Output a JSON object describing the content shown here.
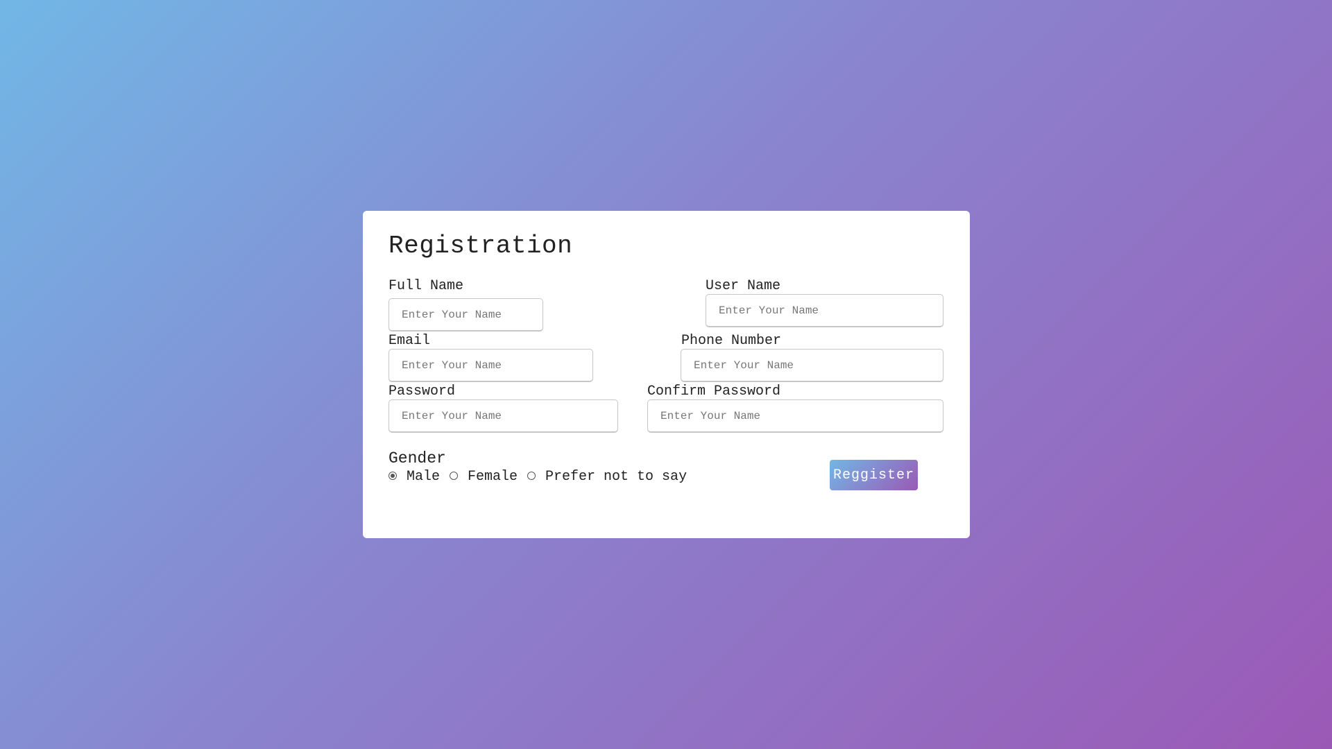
{
  "form": {
    "title": "Registration",
    "fields": {
      "full_name": {
        "label": "Full Name",
        "placeholder": "Enter Your Name"
      },
      "user_name": {
        "label": "User Name",
        "placeholder": "Enter Your Name"
      },
      "email": {
        "label": "Email",
        "placeholder": "Enter Your Name"
      },
      "phone": {
        "label": "Phone Number",
        "placeholder": "Enter Your Name"
      },
      "password": {
        "label": "Password",
        "placeholder": "Enter Your Name"
      },
      "confirm_password": {
        "label": "Confirm Password",
        "placeholder": "Enter Your Name"
      }
    },
    "gender": {
      "title": "Gender",
      "options": [
        "Male",
        "Female",
        "Prefer not to say"
      ],
      "selected": "Male"
    },
    "submit_label": "Reggister"
  },
  "colors": {
    "gradient_start": "#71b7e6",
    "gradient_end": "#9b59b6",
    "card_background": "#ffffff"
  }
}
